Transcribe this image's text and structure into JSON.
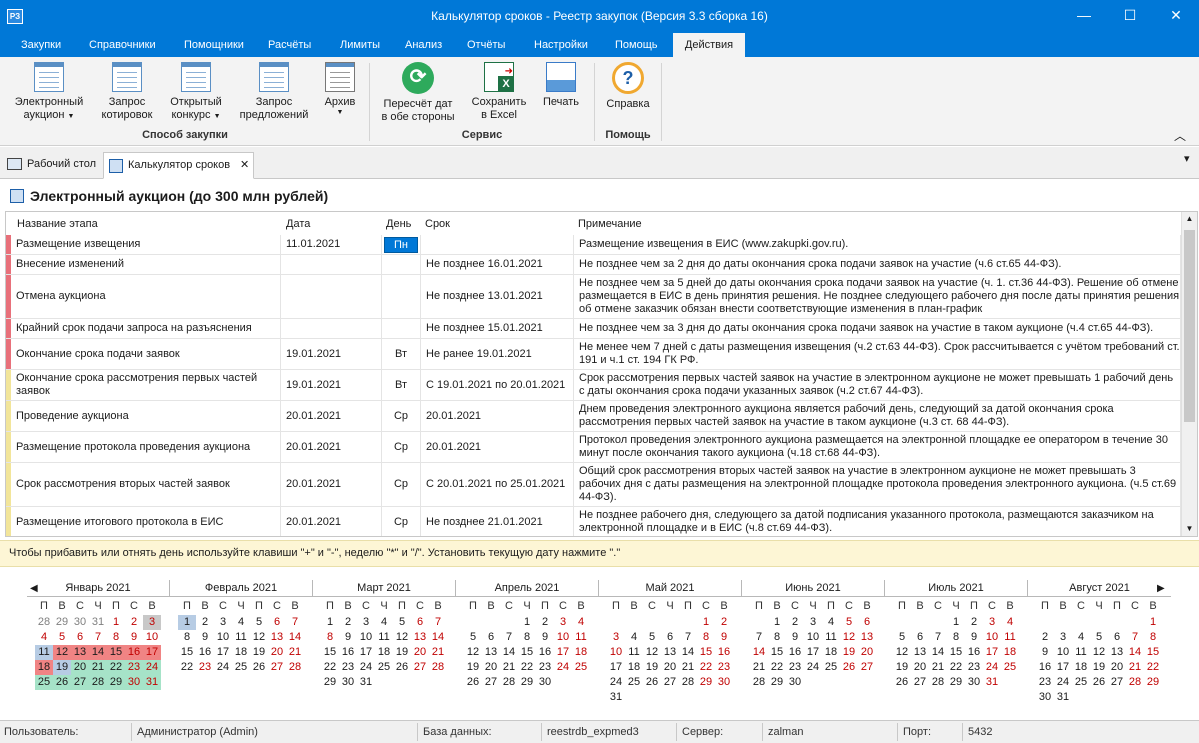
{
  "window": {
    "title": "Калькулятор сроков - Реестр закупок (Версия 3.3 сборка 16)",
    "app_icon": "app-icon",
    "minimize": "—",
    "maximize": "☐",
    "close": "✕"
  },
  "menu": {
    "tabs": [
      "Закупки",
      "Справочники",
      "Помощники",
      "Расчёты",
      "Лимиты",
      "Анализ",
      "Отчёты",
      "Настройки",
      "Помощь",
      "Действия"
    ],
    "active": "Действия"
  },
  "ribbon": {
    "buttons": [
      {
        "label1": "Электронный",
        "label2": "аукцион",
        "dropdown": true,
        "icon": "document-icon"
      },
      {
        "label1": "Запрос",
        "label2": "котировок",
        "dropdown": false,
        "icon": "document-icon"
      },
      {
        "label1": "Открытый",
        "label2": "конкурс",
        "dropdown": true,
        "icon": "document-icon"
      },
      {
        "label1": "Запрос",
        "label2": "предложений",
        "dropdown": false,
        "icon": "document-icon"
      },
      {
        "label1": "Архив",
        "label2": "",
        "dropdown": true,
        "icon": "archive-icon"
      },
      {
        "label1": "Пересчёт дат",
        "label2": "в обе стороны",
        "dropdown": false,
        "icon": "refresh-icon"
      },
      {
        "label1": "Сохранить",
        "label2": "в Excel",
        "dropdown": false,
        "icon": "excel-icon"
      },
      {
        "label1": "Печать",
        "label2": "",
        "dropdown": false,
        "icon": "print-icon"
      },
      {
        "label1": "Справка",
        "label2": "",
        "dropdown": false,
        "icon": "help-icon"
      }
    ],
    "groups": [
      "Способ закупки",
      "Сервис",
      "Помощь"
    ],
    "collapse": "︿"
  },
  "doc_tabs": [
    {
      "label": "Рабочий стол",
      "icon": "desktop-icon"
    },
    {
      "label": "Калькулятор сроков",
      "icon": "calculator-icon",
      "close": "✕"
    }
  ],
  "doc_tabs_menu": "▾",
  "page_title": "Электронный аукцион (до 300 млн рублей)",
  "grid": {
    "columns": [
      "Название этапа",
      "Дата",
      "День",
      "Срок",
      "Примечание"
    ],
    "rows": [
      {
        "stage": "Размещение извещения",
        "date": "11.01.2021",
        "day": "Пн",
        "term": "",
        "note": "Размещение извещения в ЕИС (www.zakupki.gov.ru).",
        "mark": "#e8707a",
        "day_selected": true
      },
      {
        "stage": "Внесение изменений",
        "date": "",
        "day": "",
        "term": "Не позднее 16.01.2021",
        "note": "Не позднее чем за 2 дня до даты окончания срока подачи заявок на участие (ч.6 ст.65 44-ФЗ).",
        "mark": "#e8707a"
      },
      {
        "stage": "Отмена аукциона",
        "date": "",
        "day": "",
        "term": "Не позднее 13.01.2021",
        "note": "Не позднее чем за 5 дней до даты окончания срока подачи заявок на участие (ч. 1. ст.36 44-ФЗ). Решение об отмене размещается в ЕИС в день принятия решения. Не позднее следующего рабочего дня после даты принятия решения об отмене заказчик обязан внести соответствующие изменения в план-график",
        "mark": "#e8707a"
      },
      {
        "stage": "Крайний срок подачи запроса на разъяснения",
        "date": "",
        "day": "",
        "term": "Не позднее 15.01.2021",
        "note": "Не позднее чем за 3 дня до даты окончания срока подачи заявок на участие в таком аукционе (ч.4 ст.65 44-ФЗ).",
        "mark": "#e8707a"
      },
      {
        "stage": "Окончание срока подачи заявок",
        "date": "19.01.2021",
        "day": "Вт",
        "term": "Не ранее 19.01.2021",
        "note": "Не менее чем 7 дней с даты размещения извещения (ч.2 ст.63 44-ФЗ). Срок рассчитывается с учётом требований ст. 191 и ч.1 ст. 194 ГК РФ.",
        "mark": "#e8707a"
      },
      {
        "stage": "Окончание срока рассмотрения первых частей заявок",
        "date": "19.01.2021",
        "day": "Вт",
        "term": "С 19.01.2021 по 20.01.2021",
        "note": "Срок рассмотрения первых частей заявок на участие в электронном аукционе не может превышать 1 рабочий день с даты окончания срока подачи указанных заявок (ч.2 ст.67 44-ФЗ).",
        "mark": "#f2e59a"
      },
      {
        "stage": "Проведение аукциона",
        "date": "20.01.2021",
        "day": "Ср",
        "term": "20.01.2021",
        "note": "Днем проведения электронного аукциона является рабочий день, следующий за датой окончания срока рассмотрения первых частей заявок на участие в таком аукционе (ч.3 ст. 68 44-ФЗ).",
        "mark": "#f2e59a"
      },
      {
        "stage": "Размещение протокола проведения аукциона",
        "date": "20.01.2021",
        "day": "Ср",
        "term": "20.01.2021",
        "note": "Протокол проведения электронного аукциона размещается на электронной площадке ее оператором в течение 30 минут после окончания такого аукциона (ч.18 ст.68 44-ФЗ).",
        "mark": "#f2e59a"
      },
      {
        "stage": "Срок рассмотрения вторых частей заявок",
        "date": "20.01.2021",
        "day": "Ср",
        "term": "С 20.01.2021 по 25.01.2021",
        "note": "Общий срок рассмотрения вторых частей заявок на участие в электронном аукционе не может превышать 3 рабочих дня с даты размещения на электронной площадке протокола проведения электронного аукциона. (ч.5 ст.69 44-ФЗ).",
        "mark": "#f2e59a"
      },
      {
        "stage": "Размещение итогового протокола в ЕИС",
        "date": "20.01.2021",
        "day": "Ср",
        "term": "Не позднее 21.01.2021",
        "note": "Не позднее рабочего дня, следующего за датой подписания указанного протокола, размещаются заказчиком на электронной площадке и в ЕИС (ч.8 ст.69 44-ФЗ).",
        "mark": "#f2e59a"
      }
    ]
  },
  "hint": "Чтобы прибавить или отнять день используйте клавиши \"+\" и \"-\", неделю \"*\" и \"/\". Установить текущую дату нажмите \".\"",
  "calendar": {
    "prev": "◀",
    "next": "▶",
    "weekdays": [
      "П",
      "В",
      "С",
      "Ч",
      "П",
      "С",
      "В"
    ],
    "months": [
      {
        "name": "Январь 2021",
        "first_dow": 4,
        "days": 31,
        "prev_tail": [
          28,
          29,
          30,
          31
        ]
      },
      {
        "name": "Февраль 2021",
        "first_dow": 0,
        "days": 28,
        "prev_tail": []
      },
      {
        "name": "Март 2021",
        "first_dow": 0,
        "days": 31,
        "prev_tail": []
      },
      {
        "name": "Апрель 2021",
        "first_dow": 3,
        "days": 30,
        "prev_tail": []
      },
      {
        "name": "Май 2021",
        "first_dow": 5,
        "days": 31,
        "prev_tail": []
      },
      {
        "name": "Июнь 2021",
        "first_dow": 1,
        "days": 30,
        "prev_tail": []
      },
      {
        "name": "Июль 2021",
        "first_dow": 3,
        "days": 31,
        "prev_tail": []
      },
      {
        "name": "Август 2021",
        "first_dow": 6,
        "days": 31,
        "prev_tail": []
      }
    ],
    "highlights": {
      "0": {
        "3": "#c8c8c8",
        "11": "#b7cce4",
        "12": "#f08484",
        "13": "#f08484",
        "14": "#f08484",
        "15": "#f08484",
        "16": "#f08484",
        "17": "#f08484",
        "18": "#f08484",
        "19": "#b7cce4",
        "20": "#a6e3c8",
        "21": "#a6e3c8",
        "22": "#a6e3c8",
        "23": "#a6e3c8",
        "24": "#a6e3c8",
        "25": "#a6e3c8",
        "26": "#a6e3c8",
        "27": "#a6e3c8",
        "28": "#a6e3c8",
        "29": "#a6e3c8",
        "30": "#a6e3c8",
        "31": "#a6e3c8"
      },
      "1": {
        "1": "#b7cce4"
      }
    },
    "holidays": {
      "0": [
        1,
        2,
        3,
        4,
        5,
        6,
        7,
        8,
        9,
        10
      ],
      "1": [
        23
      ],
      "2": [
        8
      ],
      "4": [
        1,
        2,
        3,
        8,
        9,
        10
      ],
      "5": [
        12,
        13,
        14
      ],
      "10": []
    }
  },
  "status": {
    "user_label": "Пользователь:",
    "user": "Администратор (Admin)",
    "db_label": "База данных:",
    "db": "reestrdb_expmed3",
    "server_label": "Сервер:",
    "server": "zalman",
    "port_label": "Порт:",
    "port": "5432"
  }
}
